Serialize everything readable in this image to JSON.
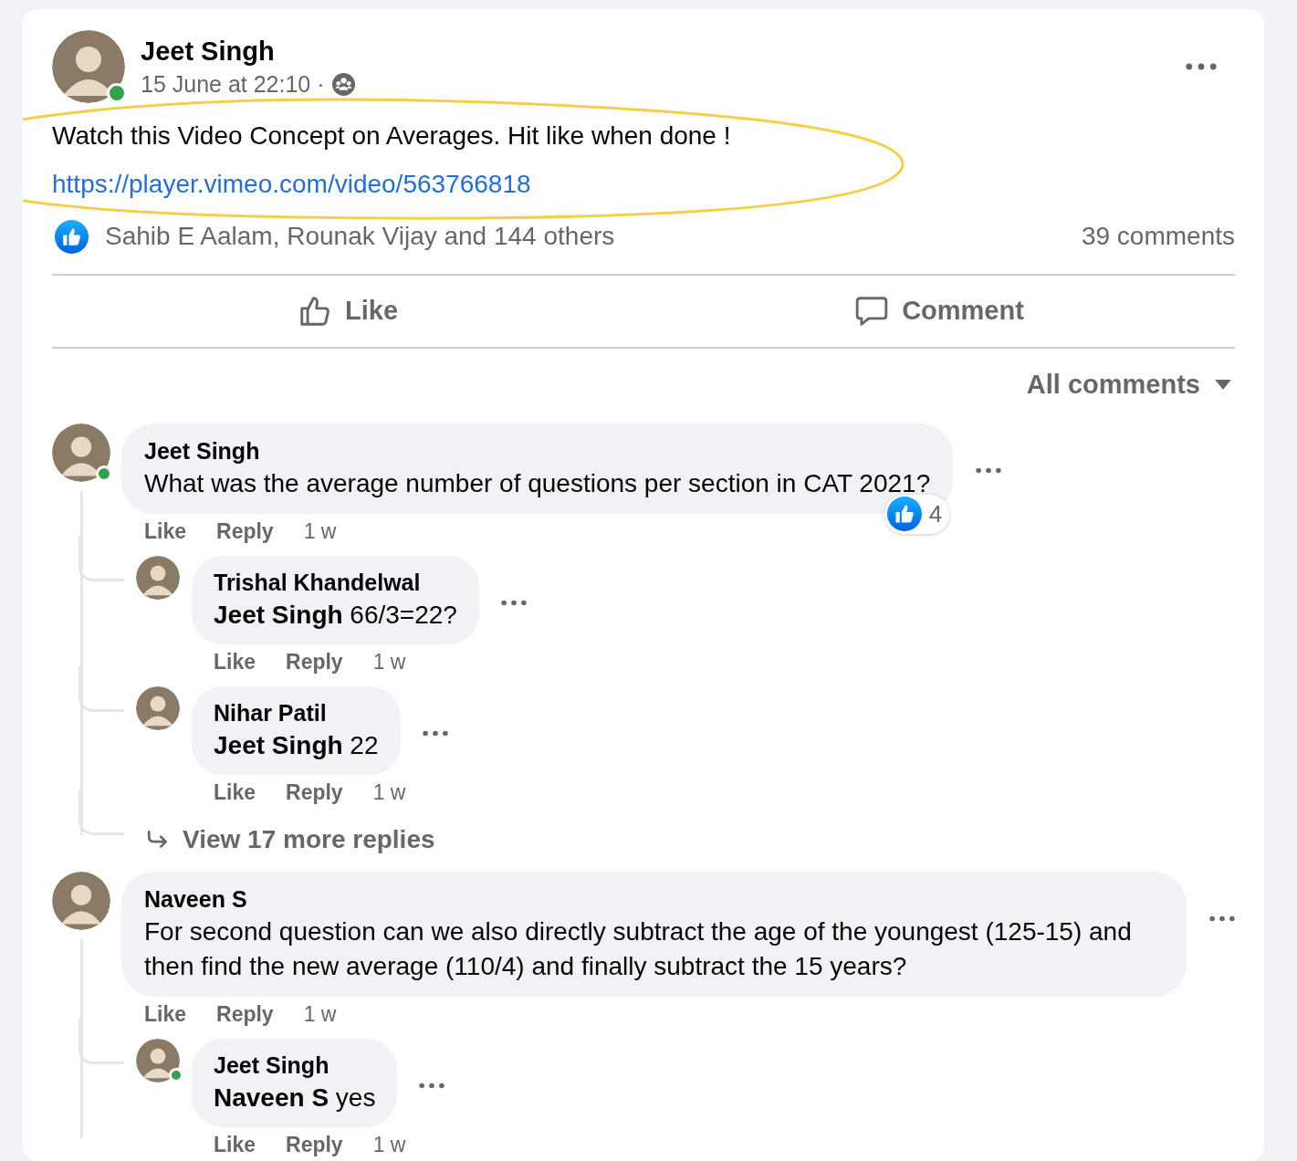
{
  "post": {
    "author": "Jeet Singh",
    "online": true,
    "timestamp": "15 June at 22:10 ·",
    "highlight_ellipse": true,
    "text": "Watch this Video Concept on Averages. Hit like when done !",
    "link": "https://player.vimeo.com/video/563766818",
    "reactions": "Sahib E Aalam, Rounak Vijay and 144 others",
    "comments_count": "39 comments",
    "actions": [
      {
        "kind": "like",
        "label": "Like"
      },
      {
        "kind": "comment",
        "label": "Comment"
      }
    ],
    "sort": "All comments"
  },
  "comments": [
    {
      "author": "Jeet Singh",
      "online": true,
      "text": "What was the average number of questions per section in CAT 2021?",
      "reaction_count": "4",
      "like": "Like",
      "reply": "Reply",
      "time": "1 w",
      "replies": [
        {
          "author": "Trishal Khandelwal",
          "text": "**Jeet Singh** 66/3=22?",
          "like": "Like",
          "reply": "Reply",
          "time": "1 w"
        },
        {
          "author": "Nihar Patil",
          "text": "**Jeet Singh** 22",
          "like": "Like",
          "reply": "Reply",
          "time": "1 w"
        }
      ],
      "more_replies": "View 17 more replies"
    },
    {
      "author": "Naveen S",
      "text": "For second question can we also directly subtract the age of the youngest (125-15) and then find the new average (110/4) and finally subtract the 15 years?",
      "like": "Like",
      "reply": "Reply",
      "time": "1 w",
      "replies": [
        {
          "author": "Jeet Singh",
          "online": true,
          "text": "**Naveen S** yes",
          "like": "Like",
          "reply": "Reply",
          "time": "1 w"
        }
      ]
    }
  ]
}
